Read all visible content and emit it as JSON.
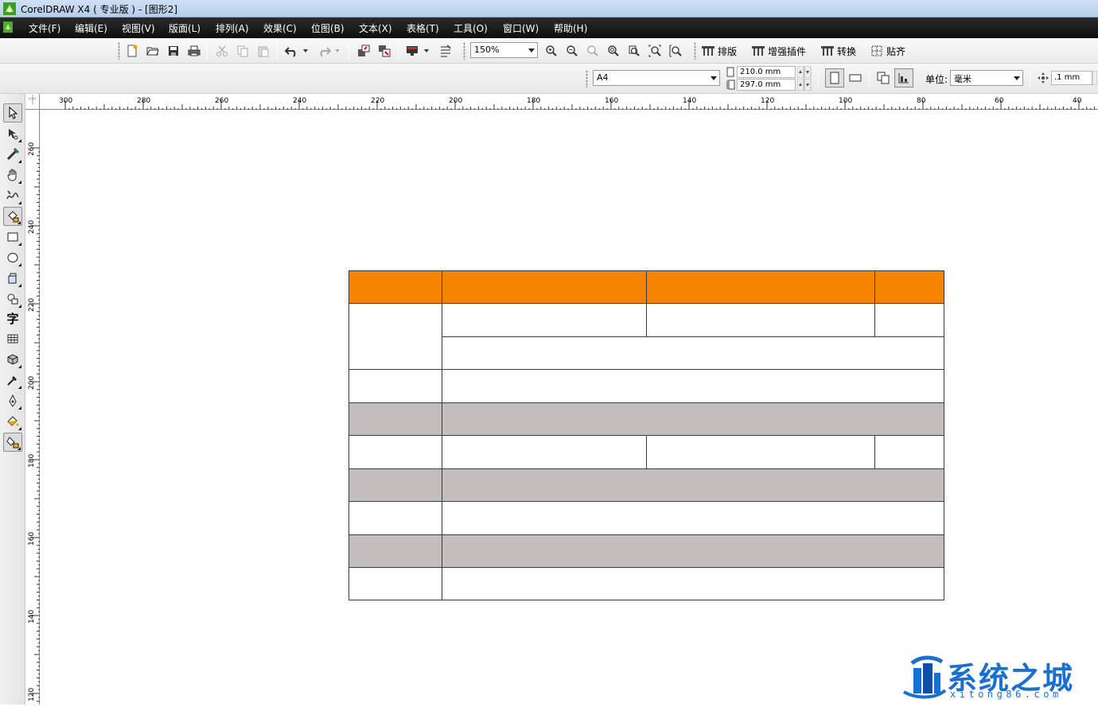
{
  "window": {
    "title": "CorelDRAW X4 ( 专业版 ) - [图形2]"
  },
  "menu": [
    "文件(F)",
    "编辑(E)",
    "视图(V)",
    "版面(L)",
    "排列(A)",
    "效果(C)",
    "位图(B)",
    "文本(X)",
    "表格(T)",
    "工具(O)",
    "窗口(W)",
    "帮助(H)"
  ],
  "toolbar": {
    "zoom": "150%",
    "text_buttons": [
      "排版",
      "增强插件",
      "转换",
      "贴齐"
    ]
  },
  "property_bar": {
    "page_size": "A4",
    "width": "210.0 mm",
    "height": "297.0 mm",
    "units_label": "单位:",
    "units": "毫米",
    "nudge": ".1 mm"
  },
  "rulers": {
    "horizontal_labels": [
      "300",
      "280",
      "260",
      "240",
      "220",
      "200",
      "180",
      "160",
      "140",
      "120",
      "100",
      "80",
      "60",
      "40"
    ],
    "vertical_labels": [
      "260",
      "240",
      "220",
      "200",
      "180",
      "160",
      "140",
      "120"
    ]
  },
  "toolbox": [
    {
      "name": "pick-tool-icon"
    },
    {
      "name": "shape-tool-icon"
    },
    {
      "name": "crop-tool-icon"
    },
    {
      "name": "pan-tool-icon"
    },
    {
      "name": "freehand-tool-icon"
    },
    {
      "name": "smart-fill-tool-icon"
    },
    {
      "name": "rectangle-tool-icon"
    },
    {
      "name": "ellipse-tool-icon"
    },
    {
      "name": "polygon-tool-icon"
    },
    {
      "name": "basic-shapes-tool-icon"
    },
    {
      "name": "text-tool-icon",
      "glyph": "字"
    },
    {
      "name": "table-tool-icon"
    },
    {
      "name": "interactive-tool-icon"
    },
    {
      "name": "eyedropper-tool-icon"
    },
    {
      "name": "outline-tool-icon"
    },
    {
      "name": "fill-tool-icon"
    },
    {
      "name": "interactive-fill-tool-icon"
    }
  ],
  "colors": {
    "header_fill": "#f48400",
    "band_fill": "#c0bfbe",
    "border": "#3b3b3b"
  },
  "watermark": {
    "text": "系统之城",
    "url": "xitong86.com"
  }
}
